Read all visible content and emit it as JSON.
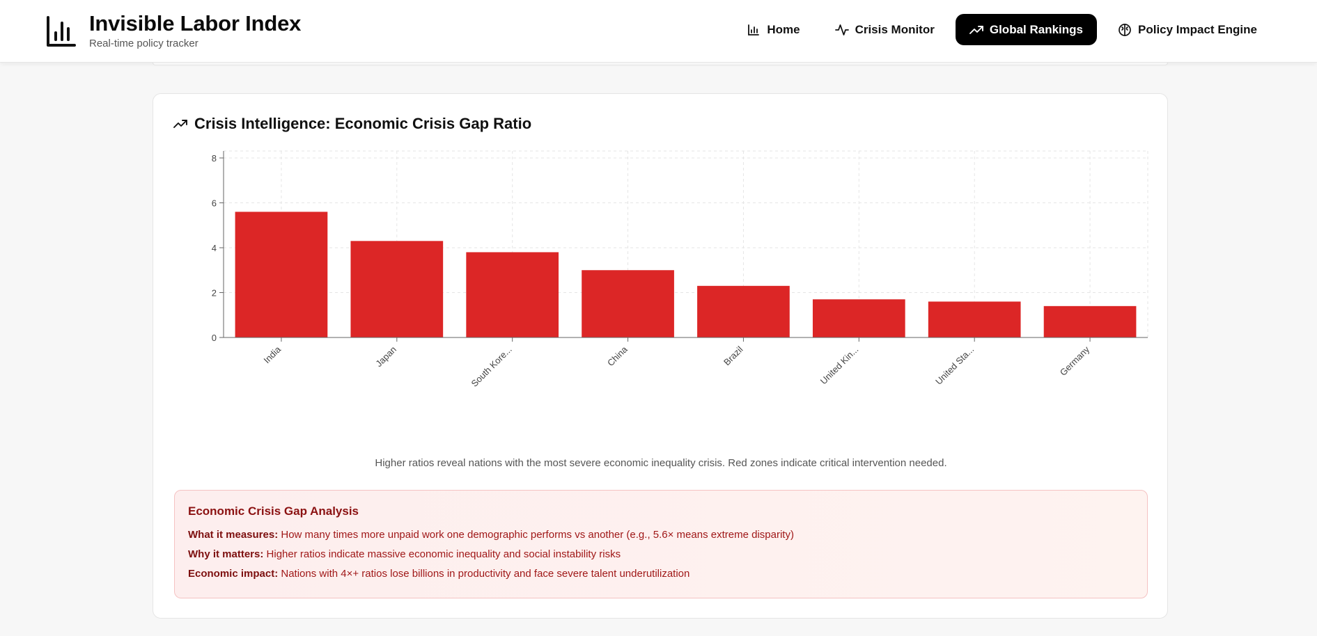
{
  "header": {
    "title": "Invisible Labor Index",
    "subtitle": "Real-time policy tracker",
    "nav": [
      {
        "label": "Home",
        "icon": "bar-chart-icon",
        "active": false
      },
      {
        "label": "Crisis Monitor",
        "icon": "activity-icon",
        "active": false
      },
      {
        "label": "Global Rankings",
        "icon": "trending-up-icon",
        "active": true
      },
      {
        "label": "Policy Impact Engine",
        "icon": "brain-icon",
        "active": false
      }
    ]
  },
  "card": {
    "title": "Crisis Intelligence: Economic Crisis Gap Ratio",
    "caption": "Higher ratios reveal nations with the most severe economic inequality crisis. Red zones indicate critical intervention needed."
  },
  "chart_data": {
    "type": "bar",
    "categories": [
      "India",
      "Japan",
      "South Kore...",
      "China",
      "Brazil",
      "United Kin...",
      "United Sta...",
      "Germany"
    ],
    "values": [
      5.6,
      4.3,
      3.8,
      3.0,
      2.3,
      1.7,
      1.6,
      1.4
    ],
    "ylim": [
      0,
      8
    ],
    "yticks": [
      0,
      2,
      4,
      6,
      8
    ],
    "grid": true,
    "bar_color": "#dc2626"
  },
  "analysis": {
    "title": "Economic Crisis Gap Analysis",
    "lines": [
      {
        "label": "What it measures:",
        "text": "How many times more unpaid work one demographic performs vs another (e.g., 5.6× means extreme disparity)"
      },
      {
        "label": "Why it matters:",
        "text": "Higher ratios indicate massive economic inequality and social instability risks"
      },
      {
        "label": "Economic impact:",
        "text": "Nations with 4×+ ratios lose billions in productivity and face severe talent underutilization"
      }
    ]
  }
}
